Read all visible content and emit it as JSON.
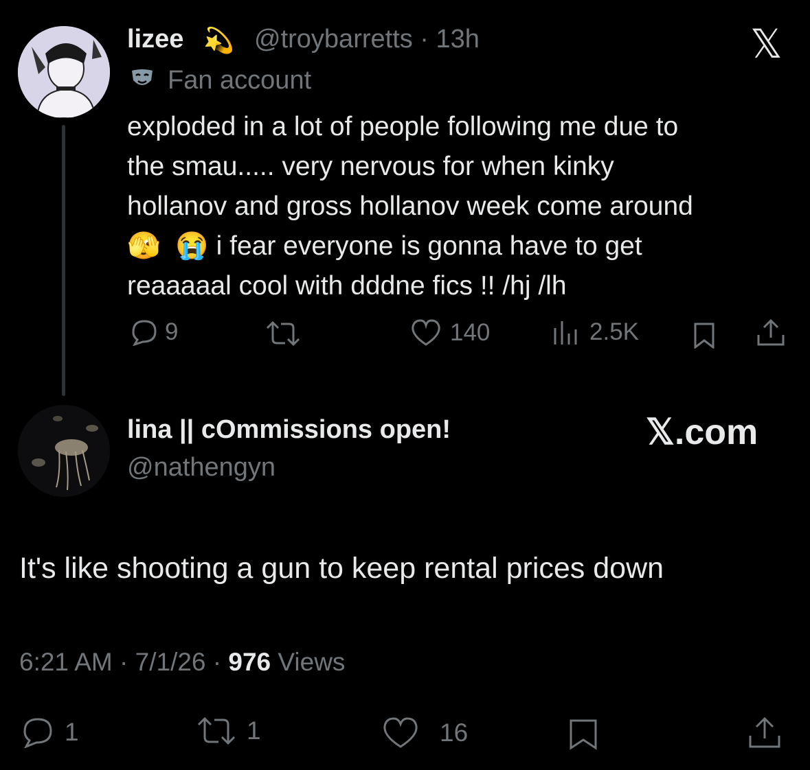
{
  "tweet1": {
    "display_name": "lizee",
    "name_emoji": "💫",
    "handle_time": "@troybarretts · 13h",
    "badge_icon": "😷",
    "badge_label": "Fan account",
    "text": "exploded in a lot of people following me due to\nthe smau..... very nervous for when kinky\nhollanov and gross hollanov week come around\n🫣  😭 i fear everyone is gonna have to get\nreaaaaal cool with dddne fics !! /hj /lh",
    "replies": "9",
    "likes": "140",
    "views": "2.5K"
  },
  "header": {
    "x_logo": "𝕏"
  },
  "tweet2": {
    "display_name": "lina || cOmmissions open!",
    "handle": "@nathengyn",
    "source_badge": "𝕏.com",
    "text": "It's like shooting a gun to keep rental prices down",
    "timestamp": "6:21 AM · 7/1/26 · ",
    "views_count": "976",
    "views_label": " Views",
    "replies": "1",
    "retweets": "1",
    "likes": "16"
  },
  "icons": {
    "reply": "reply-icon",
    "retweet": "retweet-icon",
    "like": "heart-icon",
    "views": "views-icon",
    "bookmark": "bookmark-icon",
    "share": "share-icon"
  },
  "colors": {
    "background": "#000000",
    "text": "#e7e9ea",
    "muted": "#71767b",
    "thread_line": "#2f3336"
  }
}
